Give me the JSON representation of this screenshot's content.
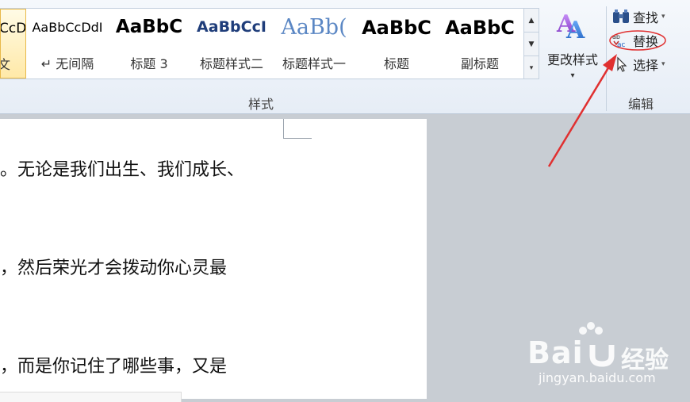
{
  "styles_gallery": {
    "tiles": [
      {
        "sample": "CcDdI",
        "name": "文"
      },
      {
        "sample": "AaBbCcDdI",
        "name": "↵ 无间隔"
      },
      {
        "sample": "AaBbC",
        "name": "标题 3"
      },
      {
        "sample": "AaBbCcI",
        "name": "标题样式二"
      },
      {
        "sample": "AaBb(",
        "name": "标题样式一"
      },
      {
        "sample": "AaBbC",
        "name": "标题"
      },
      {
        "sample": "AaBbC",
        "name": "副标题"
      }
    ],
    "group_label": "样式"
  },
  "change_styles": {
    "label": "更改样式",
    "icon": "change-styles-icon"
  },
  "editing": {
    "group_label": "编辑",
    "find_label": "查找",
    "replace_label": "替换",
    "select_label": "选择"
  },
  "document": {
    "lines": [
      "。无论是我们出生、我们成长、",
      "，然后荣光才会拨动你心灵最",
      "，而是你记住了哪些事，又是"
    ]
  },
  "watermark": {
    "brand": "Bai",
    "cn": "经验",
    "url": "jingyan.baidu.com"
  },
  "colors": {
    "accent_red": "#e03030",
    "ribbon_bg": "#e6edf6",
    "doc_bg": "#ffffff",
    "workspace": "#c8cdd3"
  }
}
